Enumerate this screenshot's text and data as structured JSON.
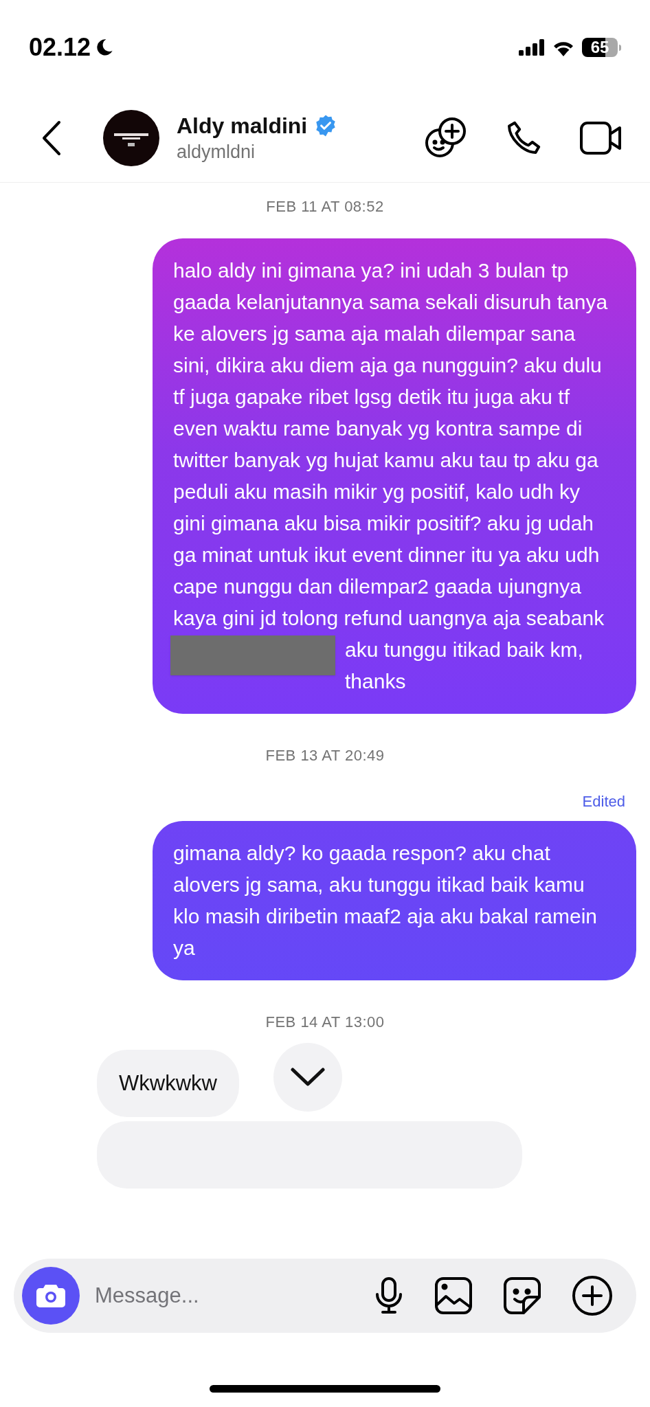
{
  "status_bar": {
    "time": "02.12",
    "battery": "65",
    "do_not_disturb": true
  },
  "header": {
    "name": "Aldy maldini",
    "username": "aldymldni",
    "verified": true
  },
  "messages": [
    {
      "kind": "date",
      "text": "FEB 11 AT 08:52"
    },
    {
      "kind": "outgoing",
      "text": "halo aldy ini gimana ya? ini udah 3 bulan tp gaada kelanjutannya sama sekali disuruh tanya ke alovers jg sama aja malah dilempar sana sini, dikira aku diem aja ga nungguin? aku dulu tf juga gapake ribet lgsg detik itu juga aku tf even waktu rame banyak yg kontra sampe di twitter banyak yg hujat kamu aku tau tp aku ga peduli aku masih mikir yg positif, kalo udh ky gini gimana aku bisa mikir positif? aku jg udah ga minat untuk ikut event dinner itu ya aku udh cape nunggu dan dilempar2 gaada ujungnya kaya gini jd tolong refund uangnya aja seabank",
      "redacted": true,
      "text_after": "aku tunggu itikad baik km, thanks"
    },
    {
      "kind": "date",
      "text": "FEB 13 AT 20:49"
    },
    {
      "kind": "outgoing",
      "edited": "Edited",
      "text": "gimana aldy? ko gaada respon? aku chat alovers jg sama, aku tunggu itikad baik kamu klo masih diribetin maaf2 aja aku bakal ramein ya"
    },
    {
      "kind": "date",
      "text": "FEB 14 AT 13:00"
    },
    {
      "kind": "incoming",
      "text": "Wkwkwkw"
    },
    {
      "kind": "clipped"
    }
  ],
  "composer": {
    "placeholder": "Message..."
  }
}
